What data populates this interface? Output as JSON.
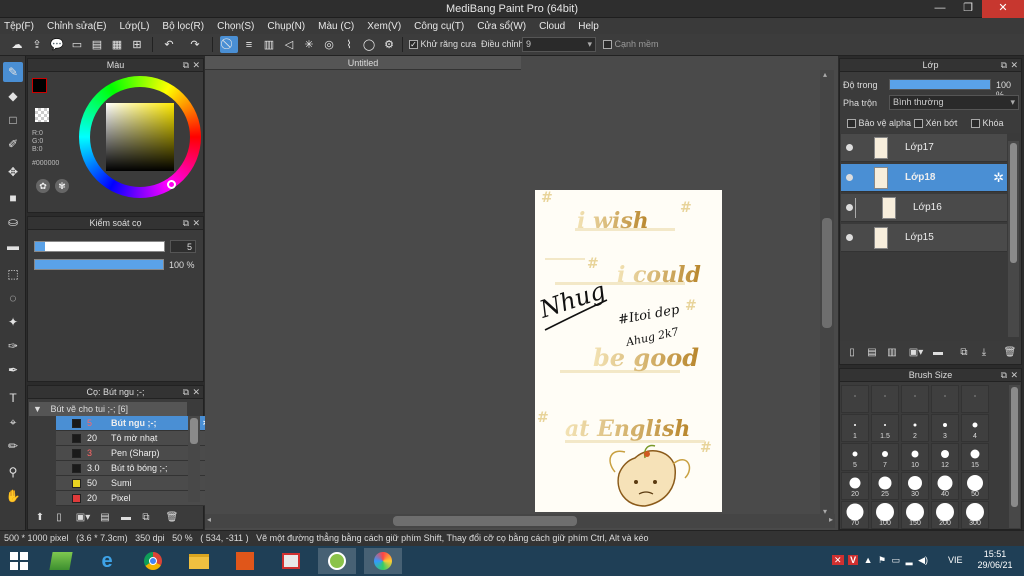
{
  "window": {
    "title": "MediBang Paint Pro (64bit)",
    "minimize": "—",
    "maximize": "❐",
    "close": "✕"
  },
  "menu": [
    "Tệp(F)",
    "Chỉnh sửa(E)",
    "Lớp(L)",
    "Bộ lọc(R)",
    "Chọn(S)",
    "Chụp(N)",
    "Màu (C)",
    "Xem(V)",
    "Công cụ(T)",
    "Cửa sổ(W)",
    "Cloud",
    "Help"
  ],
  "toolbar": {
    "antialias_label": "Khử răng cưa",
    "correction_label": "Điều chỉnh",
    "correction_value": "9",
    "edge_label": "Cạnh mềm"
  },
  "color_panel": {
    "title": "Màu",
    "primary_color": "#000000",
    "accent_color": "#cc0000",
    "r": "R:0",
    "g": "G:0",
    "b": "B:0",
    "hex": "#000000"
  },
  "brush_control": {
    "title": "Kiểm soát cọ",
    "size": "5",
    "opacity": "100 %",
    "opacity_fraction": 1.0,
    "size_fraction": 0.02
  },
  "brush_panel": {
    "title": "Cọ: Bút ngu ;-;",
    "group": "Bút vẽ cho tui ;-; [6]",
    "items": [
      {
        "size": "5",
        "name": "Bút ngu ;-;",
        "color": "#1a1a1a",
        "selected": true
      },
      {
        "size": "20",
        "name": "Tô mờ nhạt",
        "color": "#1a1a1a",
        "selected": false
      },
      {
        "size": "3",
        "name": "Pen (Sharp)",
        "color": "#1a1a1a",
        "selected": false
      },
      {
        "size": "3.0",
        "name": "Bút tô bóng ;-;",
        "color": "#1a1a1a",
        "selected": false
      },
      {
        "size": "50",
        "name": "Sumi",
        "color": "#e8d321",
        "selected": false
      },
      {
        "size": "20",
        "name": "Pixel",
        "color": "#e03a3a",
        "selected": false
      }
    ]
  },
  "document": {
    "tab": "Untitled"
  },
  "layer_panel": {
    "title": "Lớp",
    "opacity_label": "Độ trong",
    "opacity_value": "100 %",
    "opacity_fraction": 1.0,
    "blend_label": "Pha trộn",
    "blend_value": "Bình thường",
    "protect_alpha": "Bảo vệ alpha",
    "clipping": "Xén bớt",
    "lock": "Khóa",
    "layers": [
      {
        "name": "Lớp17",
        "selected": false,
        "indent": false
      },
      {
        "name": "Lớp18",
        "selected": true,
        "indent": false
      },
      {
        "name": "Lớp16",
        "selected": false,
        "indent": true
      },
      {
        "name": "Lớp15",
        "selected": false,
        "indent": false
      }
    ]
  },
  "brush_size_panel": {
    "title": "Brush Size",
    "sizes": [
      "·",
      "·",
      "·",
      "·",
      "·",
      "1",
      "1.5",
      "2",
      "3",
      "4",
      "5",
      "7",
      "10",
      "12",
      "15",
      "20",
      "25",
      "30",
      "40",
      "50",
      "70",
      "100",
      "150",
      "200",
      "300"
    ]
  },
  "status": {
    "dimensions": "500 * 1000 pixel",
    "physical": "(3.6 * 7.3cm)",
    "dpi": "350 dpi",
    "zoom": "50 %",
    "coords": "( 534, -311 )",
    "hint": "Vẽ một đường thẳng bằng cách giữ phím Shift, Thay đổi cỡ cọ bằng cách giữ phím Ctrl, Alt và kéo"
  },
  "taskbar": {
    "lang": "VIE",
    "time": "15:51",
    "date": "29/06/21"
  },
  "artwork": {
    "texts": [
      "i wish",
      "i could",
      "be good",
      "at English",
      "#Itoi dep",
      "Ahug 2k7",
      "Nhug"
    ],
    "colors": {
      "gold": "#c8a040",
      "gold_light": "#e8d49a",
      "ink": "#111111"
    }
  }
}
